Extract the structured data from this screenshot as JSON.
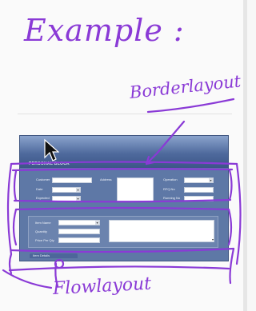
{
  "annotations": {
    "title": "Example :",
    "border_note": "Borderlayout",
    "flow_note": "Flowlayout"
  },
  "app": {
    "title": "PERSONAL BLOCK",
    "row1": {
      "customer_label": "Customer",
      "address_label": "Address",
      "operation_label": "Operation"
    },
    "row2": {
      "date_label": "Date",
      "rfq_label": "RFQ.No"
    },
    "row3": {
      "expected_label": "Expected",
      "running_label": "Running No"
    },
    "item_name_label": "Item Name",
    "quantity_label": "Quantity",
    "price_label": "Price Per Qty",
    "bottom_tab_label": "Item Details"
  },
  "colors": {
    "ink": "#8a3ad6",
    "window_bg": "#5e78a6",
    "header_top": "#8aa3cc"
  }
}
